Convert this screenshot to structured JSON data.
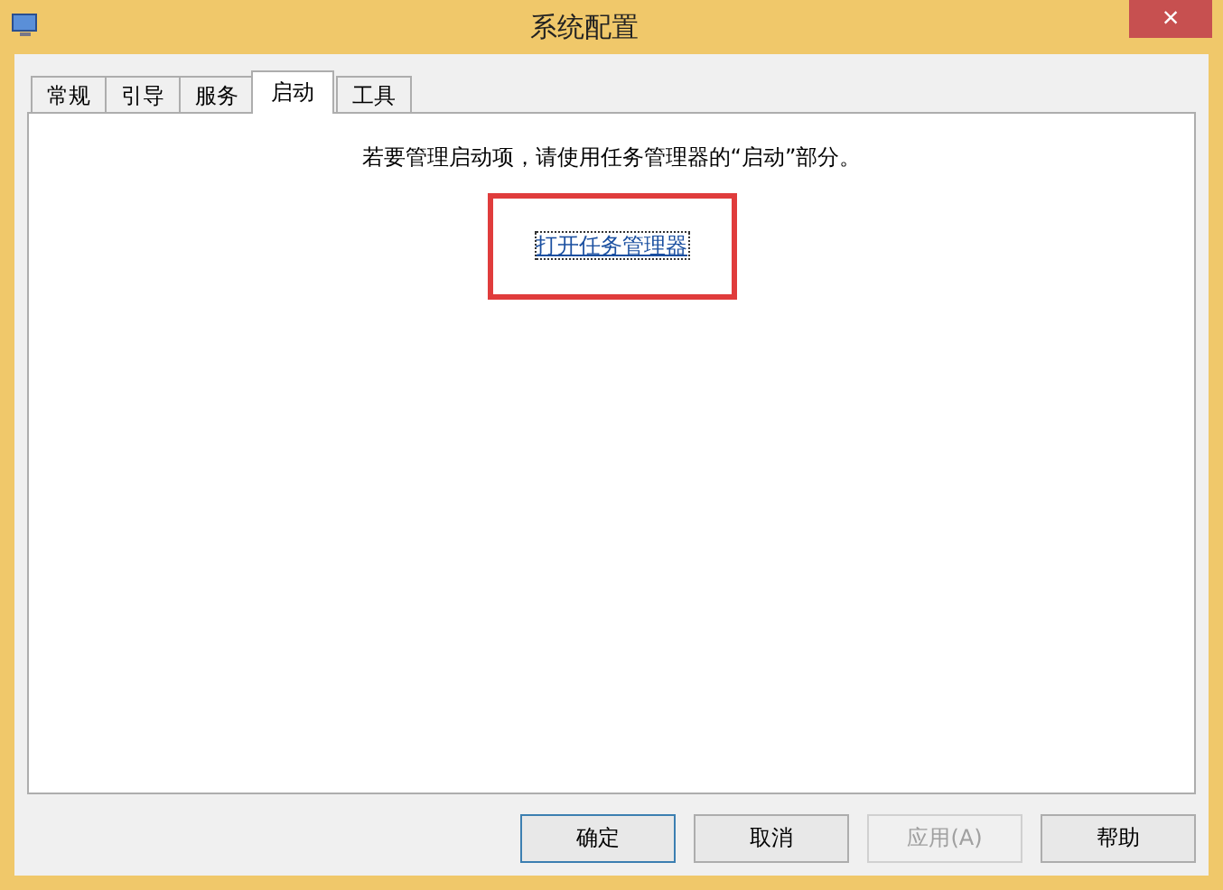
{
  "window": {
    "title": "系统配置",
    "close": "×"
  },
  "tabs": [
    {
      "label": "常规",
      "selected": false
    },
    {
      "label": "引导",
      "selected": false
    },
    {
      "label": "服务",
      "selected": false
    },
    {
      "label": "启动",
      "selected": true
    },
    {
      "label": "工具",
      "selected": false
    }
  ],
  "panel": {
    "message": "若要管理启动项，请使用任务管理器的“启动”部分。",
    "link": "打开任务管理器",
    "highlighted": true
  },
  "buttons": [
    {
      "label": "确定",
      "disabled": false,
      "selected": true
    },
    {
      "label": "取消",
      "disabled": false,
      "selected": false
    },
    {
      "label": "应用(A)",
      "disabled": true,
      "selected": false
    },
    {
      "label": "帮助",
      "disabled": false,
      "selected": false
    }
  ]
}
